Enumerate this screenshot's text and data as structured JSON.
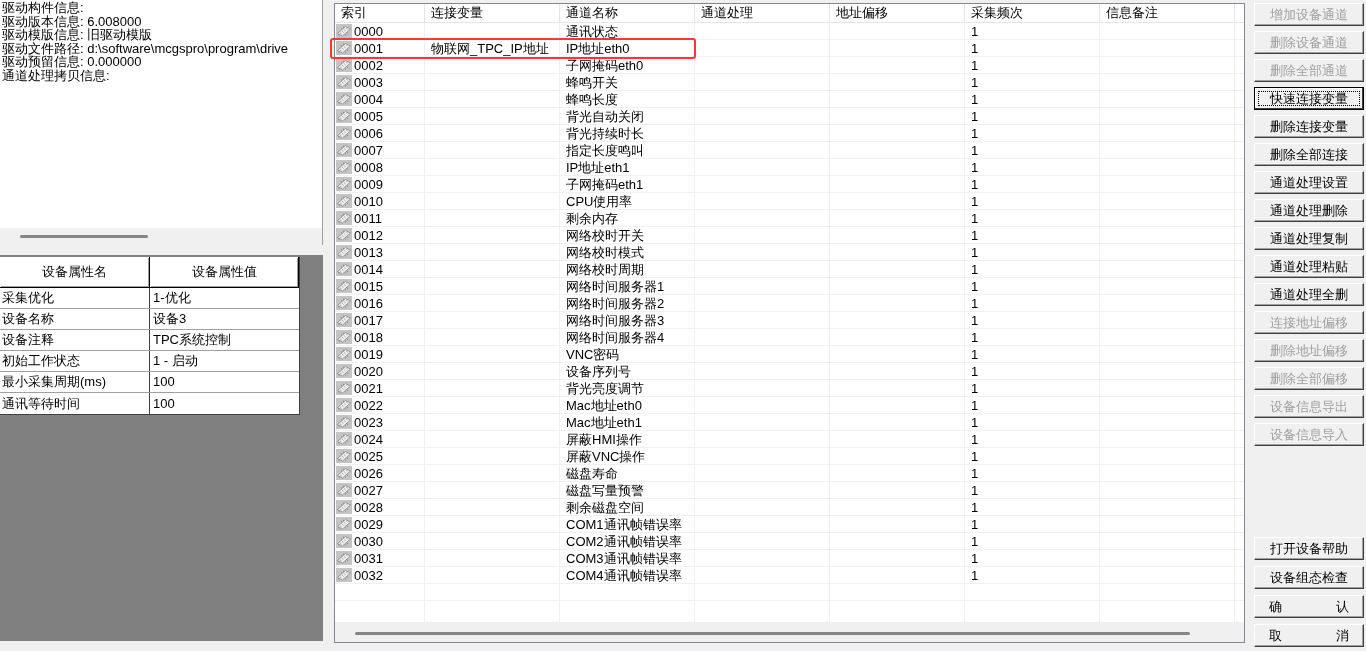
{
  "info_panel": {
    "lines": [
      "驱动构件信息:",
      "驱动版本信息: 6.008000",
      "驱动模版信息: 旧驱动模版",
      "驱动文件路径: d:\\software\\mcgspro\\program\\drive",
      "驱动预留信息: 0.000000",
      "通道处理拷贝信息:"
    ]
  },
  "property_table": {
    "columns": [
      "设备属性名",
      "设备属性值"
    ],
    "rows": [
      {
        "name": "采集优化",
        "value": "1-优化"
      },
      {
        "name": "设备名称",
        "value": "设备3"
      },
      {
        "name": "设备注释",
        "value": "TPC系统控制"
      },
      {
        "name": "初始工作状态",
        "value": "1 - 启动"
      },
      {
        "name": "最小采集周期(ms)",
        "value": "100"
      },
      {
        "name": "通讯等待时间",
        "value": "100"
      }
    ]
  },
  "channel_table": {
    "columns": [
      "索引",
      "连接变量",
      "通道名称",
      "通道处理",
      "地址偏移",
      "采集频次",
      "信息备注"
    ],
    "rows": [
      {
        "index": "0000",
        "channel_name": "通讯状态",
        "frequency": "1",
        "annotated": false
      },
      {
        "index": "0001",
        "variable": "物联网_TPC_IP地址",
        "channel_name": "IP地址eth0",
        "frequency": "1",
        "annotated": true
      },
      {
        "index": "0002",
        "channel_name": "子网掩码eth0",
        "frequency": "1",
        "annotated": false
      },
      {
        "index": "0003",
        "channel_name": "蜂鸣开关",
        "frequency": "1",
        "annotated": false
      },
      {
        "index": "0004",
        "channel_name": "蜂鸣长度",
        "frequency": "1",
        "annotated": false
      },
      {
        "index": "0005",
        "channel_name": "背光自动关闭",
        "frequency": "1",
        "annotated": false
      },
      {
        "index": "0006",
        "channel_name": "背光持续时长",
        "frequency": "1",
        "annotated": false
      },
      {
        "index": "0007",
        "channel_name": "指定长度鸣叫",
        "frequency": "1",
        "annotated": false
      },
      {
        "index": "0008",
        "channel_name": "IP地址eth1",
        "frequency": "1",
        "annotated": false
      },
      {
        "index": "0009",
        "channel_name": "子网掩码eth1",
        "frequency": "1",
        "annotated": false
      },
      {
        "index": "0010",
        "channel_name": "CPU使用率",
        "frequency": "1",
        "annotated": false
      },
      {
        "index": "0011",
        "channel_name": "剩余内存",
        "frequency": "1",
        "annotated": false
      },
      {
        "index": "0012",
        "channel_name": "网络校时开关",
        "frequency": "1",
        "annotated": false
      },
      {
        "index": "0013",
        "channel_name": "网络校时模式",
        "frequency": "1",
        "annotated": false
      },
      {
        "index": "0014",
        "channel_name": "网络校时周期",
        "frequency": "1",
        "annotated": false
      },
      {
        "index": "0015",
        "channel_name": "网络时间服务器1",
        "frequency": "1",
        "annotated": false
      },
      {
        "index": "0016",
        "channel_name": "网络时间服务器2",
        "frequency": "1",
        "annotated": false
      },
      {
        "index": "0017",
        "channel_name": "网络时间服务器3",
        "frequency": "1",
        "annotated": false
      },
      {
        "index": "0018",
        "channel_name": "网络时间服务器4",
        "frequency": "1",
        "annotated": false
      },
      {
        "index": "0019",
        "channel_name": "VNC密码",
        "frequency": "1",
        "annotated": false
      },
      {
        "index": "0020",
        "channel_name": "设备序列号",
        "frequency": "1",
        "annotated": false
      },
      {
        "index": "0021",
        "channel_name": "背光亮度调节",
        "frequency": "1",
        "annotated": false
      },
      {
        "index": "0022",
        "channel_name": "Mac地址eth0",
        "frequency": "1",
        "annotated": false
      },
      {
        "index": "0023",
        "channel_name": "Mac地址eth1",
        "frequency": "1",
        "annotated": false
      },
      {
        "index": "0024",
        "channel_name": "屏蔽HMI操作",
        "frequency": "1",
        "annotated": false
      },
      {
        "index": "0025",
        "channel_name": "屏蔽VNC操作",
        "frequency": "1",
        "annotated": false
      },
      {
        "index": "0026",
        "channel_name": "磁盘寿命",
        "frequency": "1",
        "annotated": false
      },
      {
        "index": "0027",
        "channel_name": "磁盘写量预警",
        "frequency": "1",
        "annotated": false
      },
      {
        "index": "0028",
        "channel_name": "剩余磁盘空间",
        "frequency": "1",
        "annotated": false
      },
      {
        "index": "0029",
        "channel_name": "COM1通讯帧错误率",
        "frequency": "1",
        "annotated": false
      },
      {
        "index": "0030",
        "channel_name": "COM2通讯帧错误率",
        "frequency": "1",
        "annotated": false
      },
      {
        "index": "0031",
        "channel_name": "COM3通讯帧错误率",
        "frequency": "1",
        "annotated": false
      },
      {
        "index": "0032",
        "channel_name": "COM4通讯帧错误率",
        "frequency": "1",
        "annotated": false
      }
    ]
  },
  "buttons": [
    {
      "label": "增加设备通道",
      "disabled": true,
      "focused": false
    },
    {
      "label": "删除设备通道",
      "disabled": true,
      "focused": false
    },
    {
      "label": "删除全部通道",
      "disabled": true,
      "focused": false
    },
    {
      "label": "快速连接变量",
      "disabled": false,
      "focused": true
    },
    {
      "label": "删除连接变量",
      "disabled": false,
      "focused": false
    },
    {
      "label": "删除全部连接",
      "disabled": false,
      "focused": false
    },
    {
      "label": "通道处理设置",
      "disabled": false,
      "focused": false
    },
    {
      "label": "通道处理删除",
      "disabled": false,
      "focused": false
    },
    {
      "label": "通道处理复制",
      "disabled": false,
      "focused": false
    },
    {
      "label": "通道处理粘贴",
      "disabled": false,
      "focused": false
    },
    {
      "label": "通道处理全删",
      "disabled": false,
      "focused": false
    },
    {
      "label": "连接地址偏移",
      "disabled": true,
      "focused": false
    },
    {
      "label": "删除地址偏移",
      "disabled": true,
      "focused": false
    },
    {
      "label": "删除全部偏移",
      "disabled": true,
      "focused": false
    },
    {
      "label": "设备信息导出",
      "disabled": true,
      "focused": false
    },
    {
      "label": "设备信息导入",
      "disabled": true,
      "focused": false
    }
  ],
  "dialog_buttons": [
    {
      "label": "打开设备帮助",
      "disabled": false,
      "focused": false
    },
    {
      "label": "设备组态检查",
      "disabled": false,
      "focused": false
    },
    {
      "label": "确 认",
      "disabled": false,
      "focused": false
    },
    {
      "label": "取 消",
      "disabled": false,
      "focused": false
    }
  ]
}
